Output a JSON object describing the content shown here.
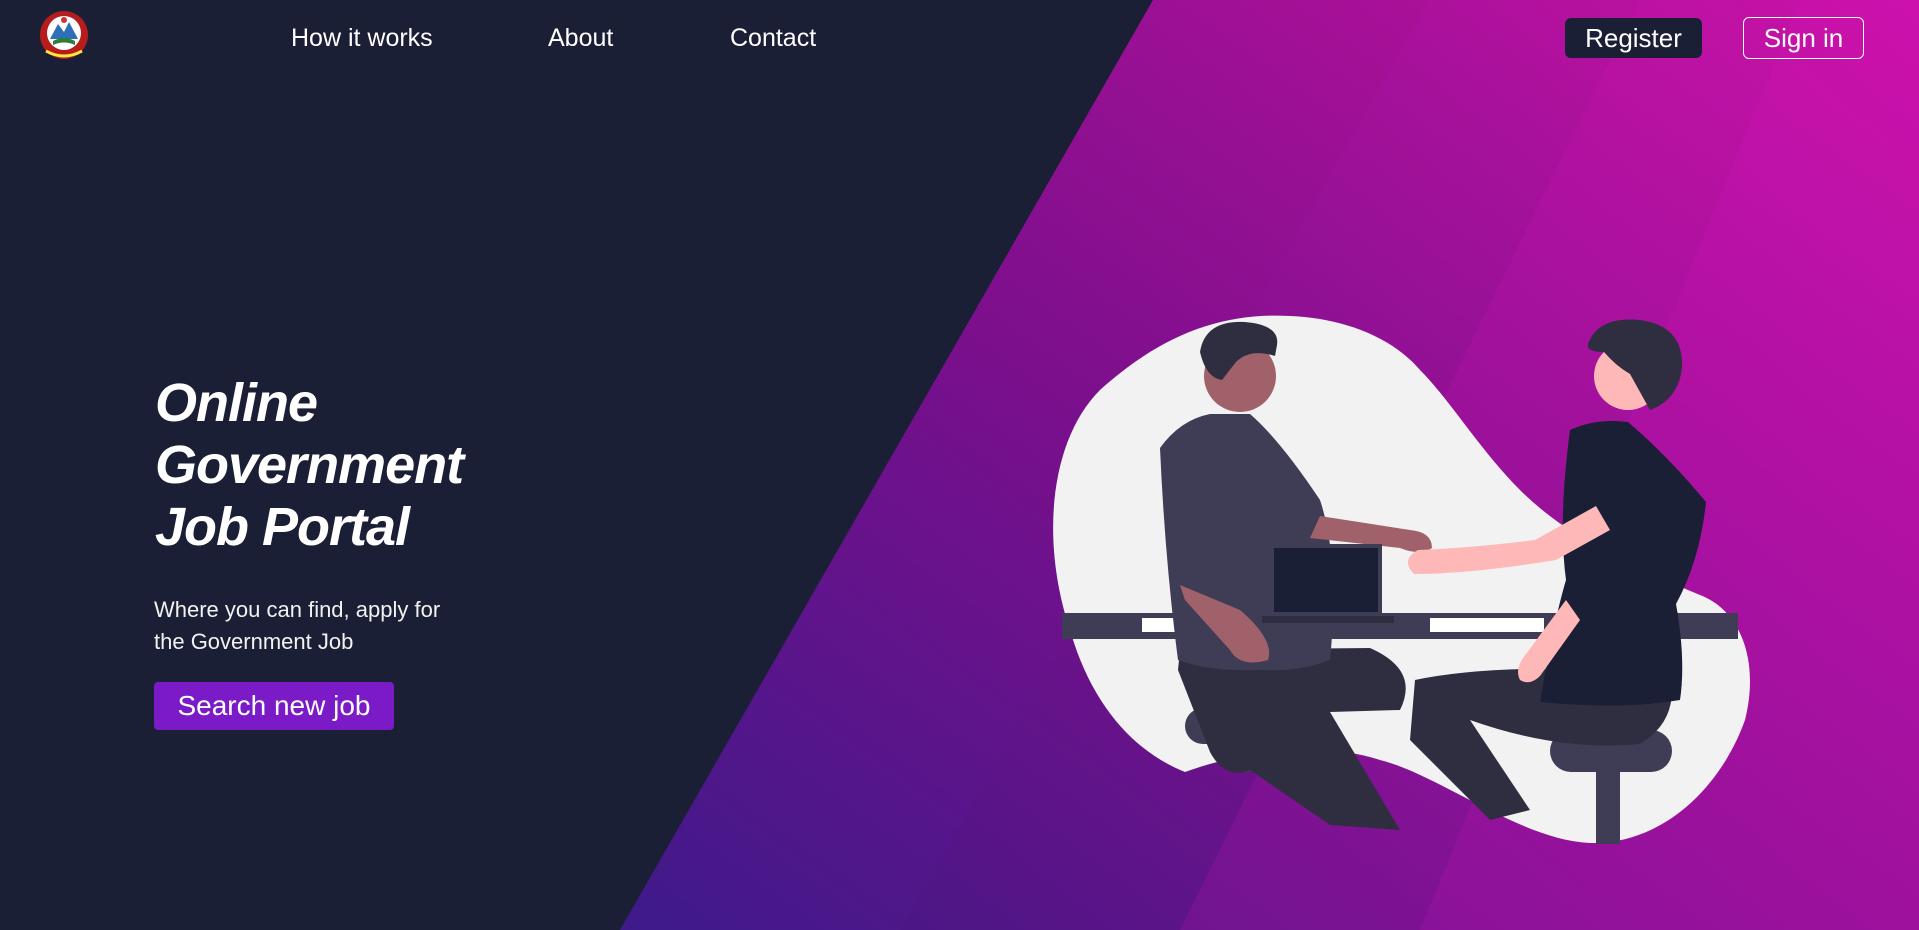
{
  "header": {
    "nav": [
      {
        "label": "How it works"
      },
      {
        "label": "About"
      },
      {
        "label": "Contact"
      }
    ],
    "register_label": "Register",
    "signin_label": "Sign in"
  },
  "hero": {
    "title_lines": [
      "Online",
      "Government",
      "Job Portal"
    ],
    "subtitle_lines": [
      "Where you can find, apply for",
      "the Government Job"
    ],
    "cta_label": "Search new job"
  },
  "colors": {
    "background": "#1a1f36",
    "gradient_magenta": "#c4119f",
    "gradient_purple": "#3e1a8a",
    "cta": "#7b1bc8"
  }
}
